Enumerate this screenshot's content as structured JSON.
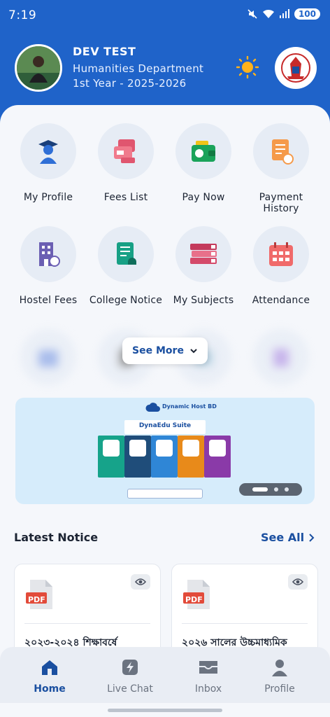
{
  "status_bar": {
    "time": "7:19",
    "battery": "100"
  },
  "header": {
    "name": "DEV TEST",
    "department": "Humanities Department",
    "year": "1st Year - 2025-2026",
    "theme_toggle_icon": "sun-icon",
    "colors": {
      "primary": "#1f63c9"
    }
  },
  "menu": {
    "items": [
      {
        "label": "My Profile",
        "icon": "student-icon"
      },
      {
        "label": "Fees List",
        "icon": "fees-card-icon"
      },
      {
        "label": "Pay Now",
        "icon": "wallet-icon"
      },
      {
        "label": "Payment History",
        "icon": "receipt-icon"
      },
      {
        "label": "Hostel Fees",
        "icon": "building-icon"
      },
      {
        "label": "College Notice",
        "icon": "notice-doc-icon"
      },
      {
        "label": "My Subjects",
        "icon": "books-icon"
      },
      {
        "label": "Attendance",
        "icon": "calendar-icon"
      }
    ],
    "see_more_label": "See More"
  },
  "banner": {
    "brand": "Dynamic Host BD",
    "title": "DynaEdu Suite",
    "slides": 3,
    "active_slide": 1
  },
  "notices": {
    "title": "Latest Notice",
    "see_all_label": "See All",
    "items": [
      {
        "badge": "PDF",
        "title": "২০২৩-২০২৪ শিক্ষাবর্ষে"
      },
      {
        "badge": "PDF",
        "title": "২০২৬ সালের উচ্চমাধ্যমিক"
      }
    ]
  },
  "bottom_nav": {
    "items": [
      {
        "label": "Home",
        "icon": "home-icon",
        "active": true
      },
      {
        "label": "Live Chat",
        "icon": "chat-icon",
        "active": false
      },
      {
        "label": "Inbox",
        "icon": "inbox-icon",
        "active": false
      },
      {
        "label": "Profile",
        "icon": "user-icon",
        "active": false
      }
    ]
  }
}
